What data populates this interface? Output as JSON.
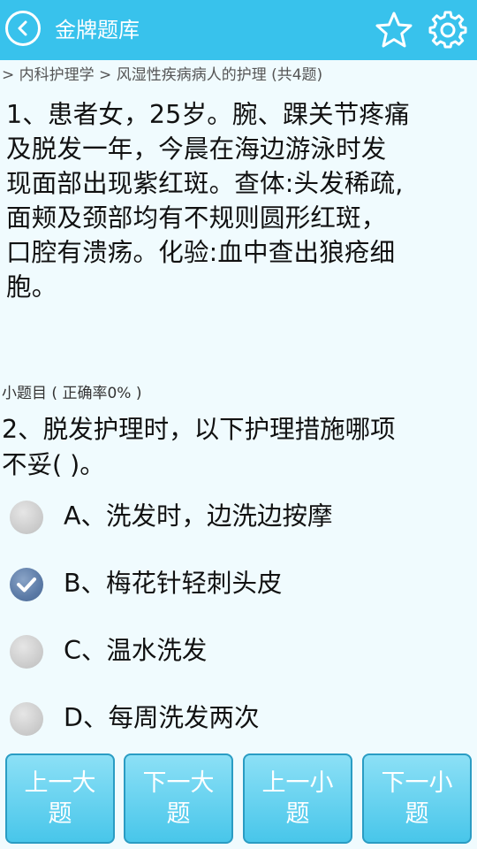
{
  "header": {
    "title": "金牌题库"
  },
  "breadcrumb": "> 内科护理学 > 风湿性疾病病人的护理 (共4题)",
  "stem_lines": [
    "1、患者女，25岁。腕、踝关节疼痛",
    "及脱发一年，今晨在海边游泳时发",
    "现面部出现紫红斑。查体:头发稀疏,",
    "面颊及颈部均有不规则圆形红斑，",
    "口腔有溃疡。化验:血中查出狼疮细",
    "胞。"
  ],
  "sub_label": "小题目 ( 正确率0% )",
  "sub_question_lines": [
    "2、脱发护理时，以下护理措施哪项",
    "不妥( )。"
  ],
  "options": [
    {
      "text": "A、洗发时，边洗边按摩",
      "checked": false
    },
    {
      "text": "B、梅花针轻刺头皮",
      "checked": true
    },
    {
      "text": "C、温水洗发",
      "checked": false
    },
    {
      "text": "D、每周洗发两次",
      "checked": false
    }
  ],
  "nav": {
    "prev_big": "上一大题",
    "next_big": "下一大题",
    "prev_small": "上一小题",
    "next_small": "下一小题"
  },
  "icons": {
    "back": "back-chevron-icon",
    "favorite": "star-icon",
    "settings": "gear-icon",
    "checked": "checkmark-icon"
  },
  "colors": {
    "header_bg": "#38c2ec",
    "page_bg": "#f0fbfe",
    "button_bg": "#48c6ea",
    "radio_checked": "#5b7aa6"
  }
}
